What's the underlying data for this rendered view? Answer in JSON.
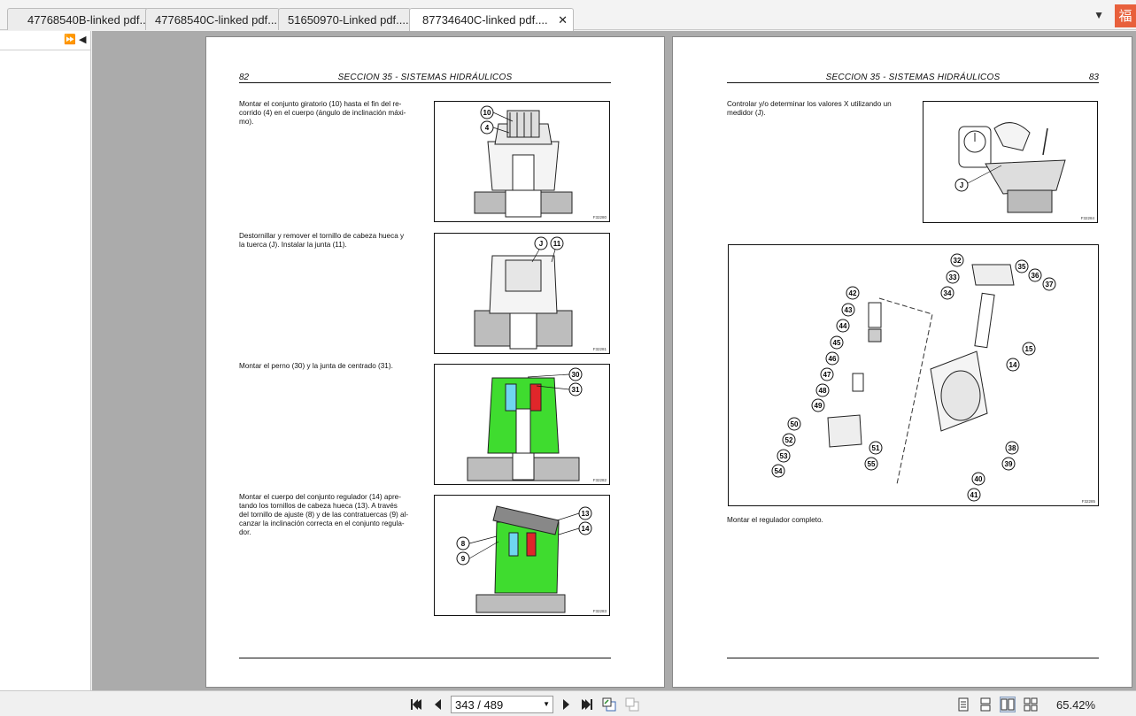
{
  "tabs": [
    {
      "label": "47768540B-linked pdf....",
      "active": false
    },
    {
      "label": "47768540C-linked pdf....",
      "active": false
    },
    {
      "label": "51650970-Linked pdf....",
      "active": false
    },
    {
      "label": "87734640C-linked pdf....",
      "active": true
    }
  ],
  "tab_overflow_icon": "chevron-down-icon",
  "corner_badge": "福",
  "left_page": {
    "number": "82",
    "header": "SECCION 35 - SISTEMAS HIDRÁULICOS",
    "paragraphs": [
      "Montar el conjunto giratorio (10) hasta el fin del re-\ncorrido (4) en el cuerpo (ángulo de inclinación máxi-\nmo).",
      "Destornillar y remover el tornillo de cabeza hueca y\nla tuerca (J). Instalar la junta (11).",
      "Montar el perno (30) y la junta de centrado (31).",
      "Montar el cuerpo del conjunto regulador (14) apre-\ntando los tornillos de cabeza hueca (13). A través\ndel tornillo de ajuste (8) y de las contratuercas (9) al-\ncanzar la inclinación correcta en el conjunto regula-\ndor."
    ],
    "figures": [
      {
        "code": "F32280",
        "callouts": [
          "10",
          "4"
        ]
      },
      {
        "code": "F32281",
        "callouts": [
          "J",
          "11"
        ]
      },
      {
        "code": "F32282",
        "callouts": [
          "30",
          "31"
        ]
      },
      {
        "code": "F32283",
        "callouts": [
          "13",
          "14",
          "8",
          "9"
        ]
      }
    ]
  },
  "right_page": {
    "number": "83",
    "header": "SECCION 35 - SISTEMAS HIDRÁULICOS",
    "paragraphs": [
      "Controlar y/o determinar los valores X utilizando un\nmedidor (J).",
      "Montar el regulador completo."
    ],
    "figures": [
      {
        "code": "F32284",
        "callouts": [
          "J"
        ]
      },
      {
        "code": "F32285",
        "callouts": [
          "32",
          "33",
          "34",
          "35",
          "36",
          "37",
          "42",
          "43",
          "44",
          "45",
          "46",
          "47",
          "48",
          "49",
          "15",
          "14",
          "50",
          "51",
          "52",
          "53",
          "54",
          "55",
          "38",
          "39",
          "40",
          "41"
        ]
      }
    ]
  },
  "toolbar": {
    "page_display": "343 / 489",
    "zoom": "65.42%"
  },
  "colors": {
    "doc_bg": "#ababab",
    "highlight_green": "#3fdc2f",
    "highlight_cyan": "#6fd6f0",
    "highlight_red": "#e0262a",
    "badge": "#e8603c"
  }
}
